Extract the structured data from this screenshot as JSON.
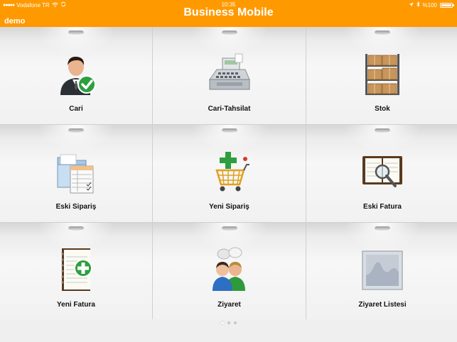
{
  "status_bar": {
    "carrier": "Vodafone TR",
    "time": "10:35",
    "battery": "%100"
  },
  "header": {
    "title": "Business Mobile",
    "user": "demo",
    "background_color": "#ff9900"
  },
  "tiles": [
    {
      "label": "Cari",
      "icon": "customer-check-icon"
    },
    {
      "label": "Cari-Tahsilat",
      "icon": "cash-register-icon"
    },
    {
      "label": "Stok",
      "icon": "warehouse-shelf-icon"
    },
    {
      "label": "Eski Sipariş",
      "icon": "folder-documents-icon"
    },
    {
      "label": "Yeni Sipariş",
      "icon": "shopping-cart-add-icon"
    },
    {
      "label": "Eski Fatura",
      "icon": "notebook-search-icon"
    },
    {
      "label": "Yeni Fatura",
      "icon": "notebook-add-icon"
    },
    {
      "label": "Ziyaret",
      "icon": "people-chat-icon"
    },
    {
      "label": "Ziyaret Listesi",
      "icon": "chart-image-icon"
    }
  ],
  "pager": {
    "pages": 3,
    "current": 1
  }
}
